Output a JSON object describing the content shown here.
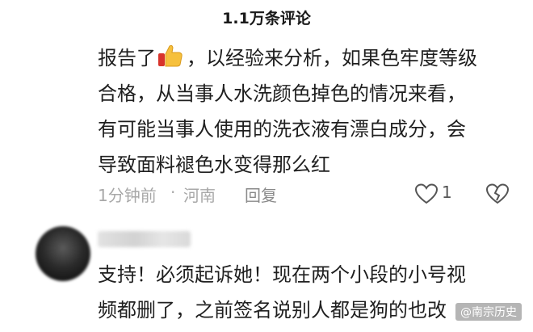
{
  "header": {
    "title": "1.1万条评论"
  },
  "comment1": {
    "text_before_emoji": "报告了",
    "emoji": "thumbs-up",
    "text_line1_after": "，以经验来分析，如果色牢度等级",
    "line2": "合格，从当事人水洗颜色掉色的情况来看，",
    "line3": "有可能当事人使用的洗衣液有漂白成分，会",
    "line4": "导致面料褪色水变得那么红",
    "time": "1分钟前",
    "separator": "·",
    "location": "河南",
    "reply_label": "回复",
    "like_count": "1"
  },
  "comment2": {
    "line1": "支持！必须起诉她！现在两个小段的小号视",
    "line2": "频都删了，之前签名说别人都是狗的也改"
  },
  "watermark": "@南宗历史",
  "colors": {
    "meta": "#a8a8a8",
    "text": "#1f1f1f"
  }
}
